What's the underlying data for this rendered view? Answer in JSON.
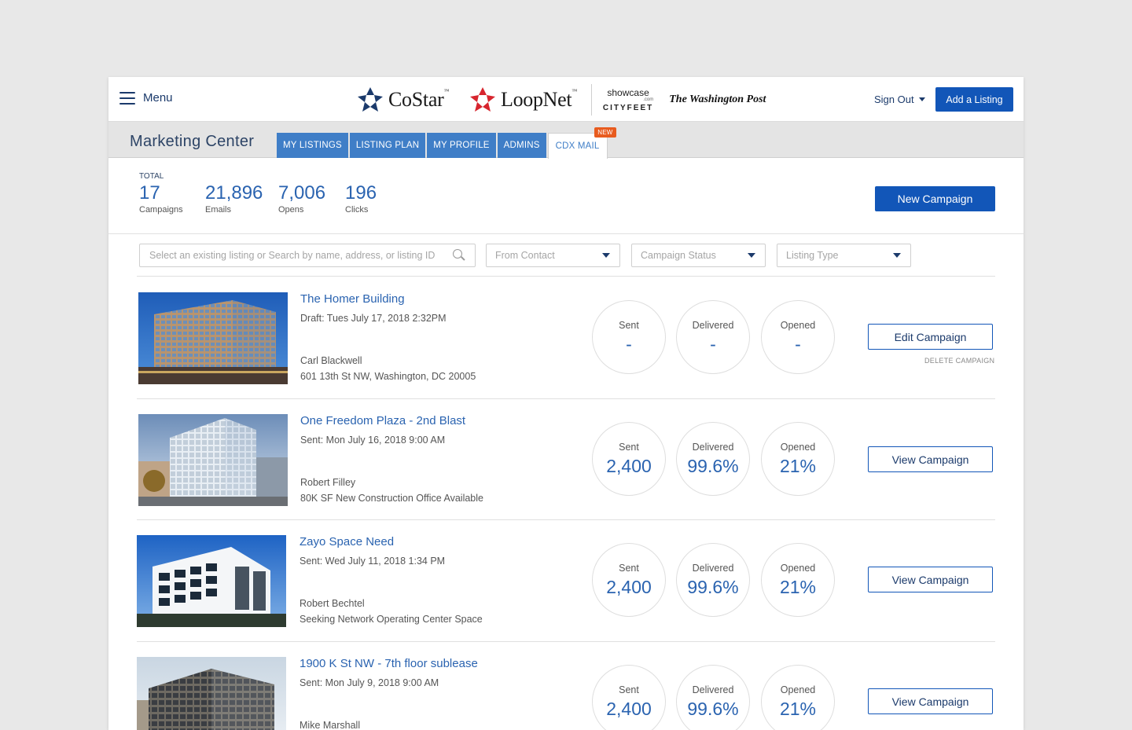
{
  "nav": {
    "menu_label": "Menu",
    "brands": {
      "costar": "CoStar",
      "loopnet": "LoopNet",
      "tm": "™",
      "showcase": "showcase",
      "showcase_com": ".com",
      "cityfeet": "CITYFEET",
      "wapo": "The Washington Post"
    },
    "sign_out": "Sign Out",
    "add_listing": "Add a Listing"
  },
  "marketing": {
    "title": "Marketing Center",
    "tabs": [
      "MY LISTINGS",
      "LISTING PLAN",
      "MY PROFILE",
      "ADMINS",
      "CDX MAIL"
    ],
    "active_tab": "CDX MAIL",
    "new_badge": "NEW"
  },
  "stats": {
    "total_label": "TOTAL",
    "items": [
      {
        "value": "17",
        "label": "Campaigns"
      },
      {
        "value": "21,896",
        "label": "Emails"
      },
      {
        "value": "7,006",
        "label": "Opens"
      },
      {
        "value": "196",
        "label": "Clicks"
      }
    ],
    "new_campaign": "New Campaign"
  },
  "filters": {
    "search_placeholder": "Select an existing listing or Search by name, address, or listing ID",
    "from_contact": "From Contact",
    "campaign_status": "Campaign Status",
    "listing_type": "Listing Type"
  },
  "campaigns": [
    {
      "title": "The Homer Building",
      "date": "Draft: Tues July 17, 2018  2:32PM",
      "owner": "Carl Blackwell",
      "address": "601 13th St NW, Washington, DC 20005",
      "sent_label": "Sent",
      "sent": "-",
      "delivered_label": "Delivered",
      "delivered": "-",
      "opened_label": "Opened",
      "opened": "-",
      "action": "Edit Campaign",
      "delete": "DELETE CAMPAIGN"
    },
    {
      "title": "One Freedom Plaza - 2nd Blast",
      "date": "Sent: Mon July 16, 2018 9:00 AM",
      "owner": "Robert Filley",
      "address": "80K SF New Construction Office Available",
      "sent_label": "Sent",
      "sent": "2,400",
      "delivered_label": "Delivered",
      "delivered": "99.6%",
      "opened_label": "Opened",
      "opened": "21%",
      "action": "View Campaign"
    },
    {
      "title": "Zayo Space Need",
      "date": "Sent: Wed July 11, 2018 1:34 PM",
      "owner": "Robert Bechtel",
      "address": "Seeking Network Operating Center Space",
      "sent_label": "Sent",
      "sent": "2,400",
      "delivered_label": "Delivered",
      "delivered": "99.6%",
      "opened_label": "Opened",
      "opened": "21%",
      "action": "View Campaign"
    },
    {
      "title": "1900 K St NW - 7th floor sublease",
      "date": "Sent: Mon July 9, 2018 9:00 AM",
      "owner": "Mike Marshall",
      "address": "",
      "sent_label": "Sent",
      "sent": "2,400",
      "delivered_label": "Delivered",
      "delivered": "99.6%",
      "opened_label": "Opened",
      "opened": "21%",
      "action": "View Campaign"
    }
  ],
  "colors": {
    "primary": "#1256b8",
    "tab": "#3f7ec7",
    "link": "#2a63b0",
    "badge": "#e85b1e"
  }
}
